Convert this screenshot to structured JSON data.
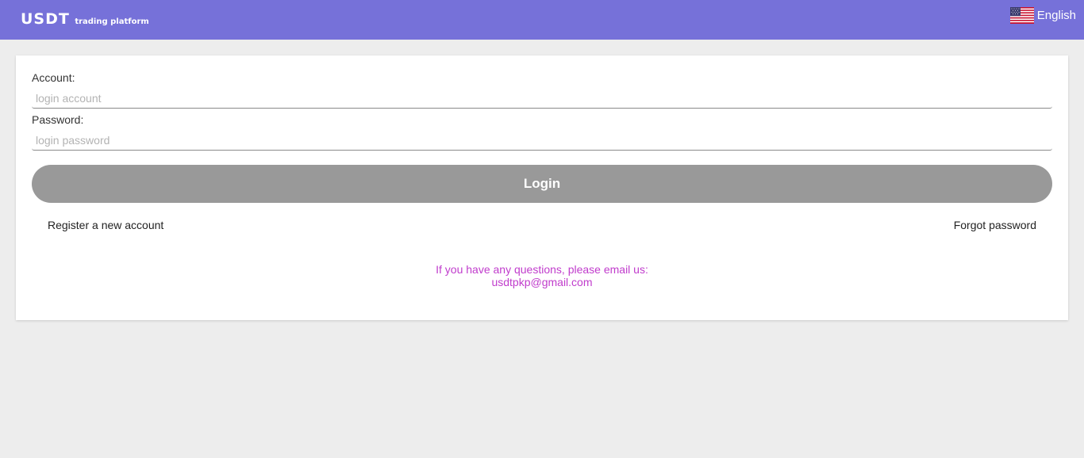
{
  "header": {
    "logo_main": "USDT",
    "logo_sub": "trading platform",
    "language": "English",
    "language_flag": "us-flag-icon"
  },
  "login_form": {
    "account_label": "Account:",
    "account_placeholder": "login account",
    "account_value": "",
    "password_label": "Password:",
    "password_placeholder": "login password",
    "password_value": "",
    "login_button": "Login",
    "register_link": "Register a new account",
    "forgot_link": "Forgot password"
  },
  "contact": {
    "line1": "If you have any questions, please email us:",
    "email": "usdtpkp@gmail.com"
  },
  "colors": {
    "header_bg": "#7671d9",
    "page_bg": "#ededed",
    "button_bg": "#999999",
    "contact_text": "#c03ccc"
  }
}
